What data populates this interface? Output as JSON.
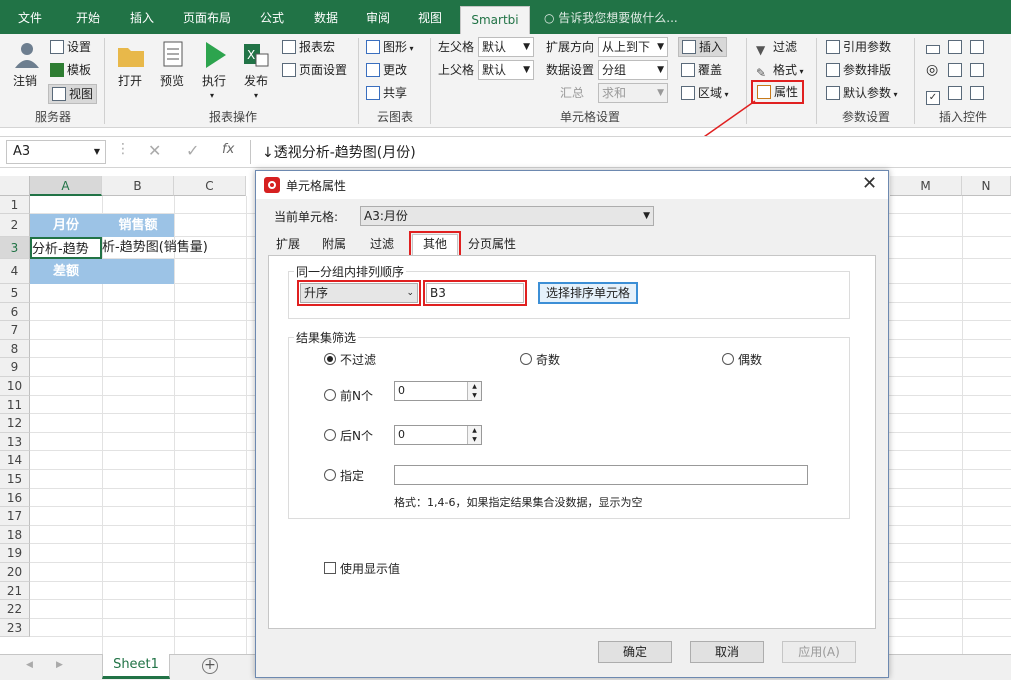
{
  "ribbon_tabs": [
    "文件",
    "开始",
    "插入",
    "页面布局",
    "公式",
    "数据",
    "审阅",
    "视图",
    "Smartbi"
  ],
  "tell_me": "告诉我您想要做什么...",
  "server": {
    "login": "注销",
    "settings": "设置",
    "template": "模板",
    "view": "视图",
    "group": "服务器"
  },
  "report_ops": {
    "open": "打开",
    "preview": "预览",
    "execute": "执行",
    "publish": "发布",
    "macro": "报表宏",
    "page_setup": "页面设置",
    "group": "报表操作"
  },
  "cloud": {
    "chart": "图形",
    "change": "更改",
    "share": "共享",
    "group": "云图表"
  },
  "cell_settings": {
    "left_parent_label": "左父格",
    "left_parent_value": "默认",
    "top_parent_label": "上父格",
    "top_parent_value": "默认",
    "expand_dir_label": "扩展方向",
    "expand_dir_value": "从上到下",
    "data_set_label": "数据设置",
    "data_set_value": "分组",
    "summary_label": "汇总",
    "summary_value": "求和",
    "insert": "插入",
    "overwrite": "覆盖",
    "region": "区域",
    "group": "单元格设置"
  },
  "filter_group": {
    "filter": "过滤",
    "format": "格式",
    "properties": "属性"
  },
  "params": {
    "ref": "引用参数",
    "layout": "参数排版",
    "default": "默认参数",
    "group": "参数设置"
  },
  "controls_group": "插入控件",
  "namebox": "A3",
  "formula": "↓透视分析-趋势图(月份)",
  "columns": [
    "A",
    "B",
    "C",
    "M",
    "N"
  ],
  "rows": [
    "1",
    "2",
    "3",
    "4",
    "5",
    "6",
    "7",
    "8",
    "9",
    "10",
    "11",
    "12",
    "13",
    "14",
    "15",
    "16",
    "17",
    "18",
    "19",
    "20",
    "21",
    "22",
    "23"
  ],
  "cells": {
    "a2": "月份",
    "b2": "销售额",
    "a3": "分析-趋势",
    "b3": "析-趋势图(销售量)",
    "a4": "差额"
  },
  "sheet_tab": "Sheet1",
  "dialog": {
    "title": "单元格属性",
    "current_cell_label": "当前单元格:",
    "current_cell_value": "A3:月份",
    "tabs": [
      "扩展",
      "附属",
      "过滤",
      "其他",
      "分页属性"
    ],
    "sort_group_label": "同一分组内排列顺序",
    "sort_order": "升序",
    "sort_cell": "B3",
    "choose_sort_btn": "选择排序单元格",
    "result_filter_label": "结果集筛选",
    "no_filter": "不过滤",
    "odd": "奇数",
    "even": "偶数",
    "top_n": "前N个",
    "top_n_value": "0",
    "bottom_n": "后N个",
    "bottom_n_value": "0",
    "specify": "指定",
    "format_hint": "格式：1,4-6，如果指定结果集合没数据，显示为空",
    "use_display": "使用显示值",
    "ok": "确定",
    "cancel": "取消",
    "apply": "应用(A)"
  }
}
